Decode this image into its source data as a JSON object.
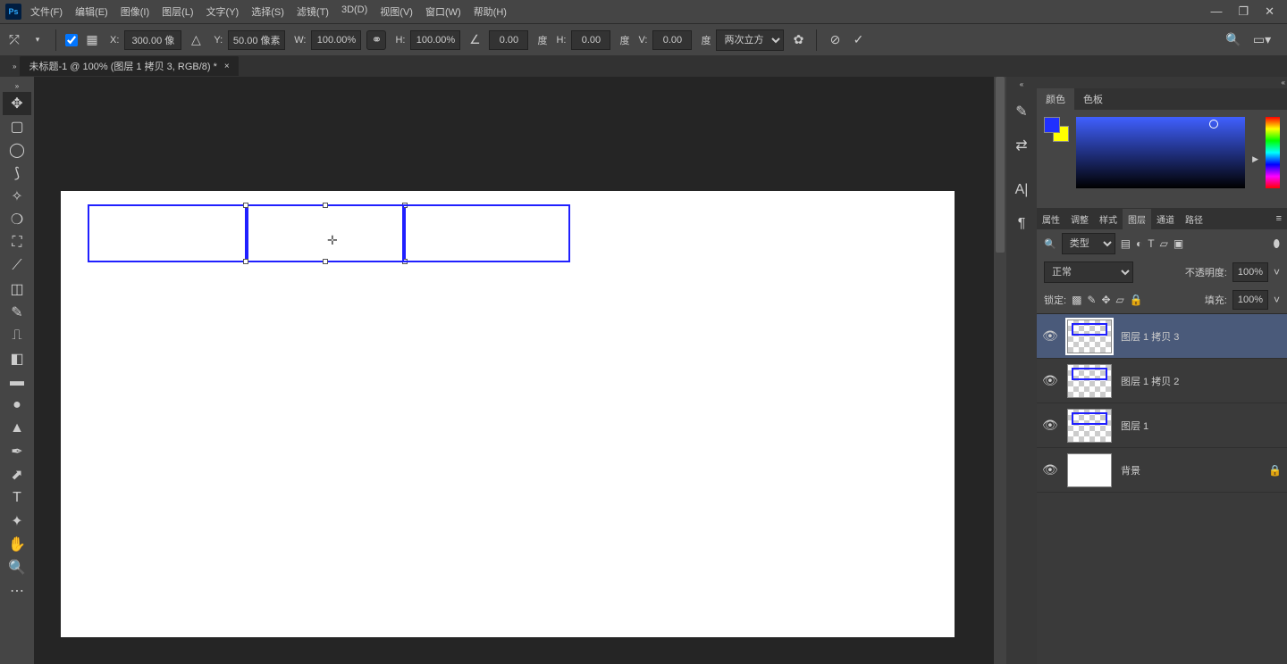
{
  "app": {
    "logo": "Ps"
  },
  "menu": {
    "file": "文件(F)",
    "edit": "编辑(E)",
    "image": "图像(I)",
    "layer": "图层(L)",
    "type": "文字(Y)",
    "select": "选择(S)",
    "filter": "滤镜(T)",
    "d3": "3D(D)",
    "view": "视图(V)",
    "window": "窗口(W)",
    "help": "帮助(H)"
  },
  "opt": {
    "x_lbl": "X:",
    "x": "300.00 像",
    "y_lbl": "Y:",
    "y": "50.00 像素",
    "w_lbl": "W:",
    "w": "100.00%",
    "h_lbl": "H:",
    "h": "100.00%",
    "angle": "0.00",
    "angle_unit": "度",
    "hskew_lbl": "H:",
    "hskew": "0.00",
    "hskew_unit": "度",
    "vskew_lbl": "V:",
    "vskew": "0.00",
    "vskew_unit": "度",
    "interp": "两次立方"
  },
  "tab": {
    "title": "未标题-1 @ 100% (图层 1 拷贝 3, RGB/8) *"
  },
  "panels": {
    "color_tab": "颜色",
    "swatch_tab": "色板",
    "prop": "属性",
    "adjust": "调整",
    "styles": "样式",
    "layers": "图层",
    "channels": "通道",
    "paths": "路径",
    "type_search": "类型",
    "blend": "正常",
    "opacity_lbl": "不透明度:",
    "opacity": "100%",
    "lock_lbl": "锁定:",
    "fill_lbl": "填充:",
    "fill": "100%"
  },
  "layers": [
    {
      "name": "图层 1 拷贝 3",
      "selected": true,
      "checker": true
    },
    {
      "name": "图层 1 拷贝 2",
      "selected": false,
      "checker": true
    },
    {
      "name": "图层 1",
      "selected": false,
      "checker": true
    },
    {
      "name": "背景",
      "selected": false,
      "checker": false,
      "locked": true
    }
  ]
}
